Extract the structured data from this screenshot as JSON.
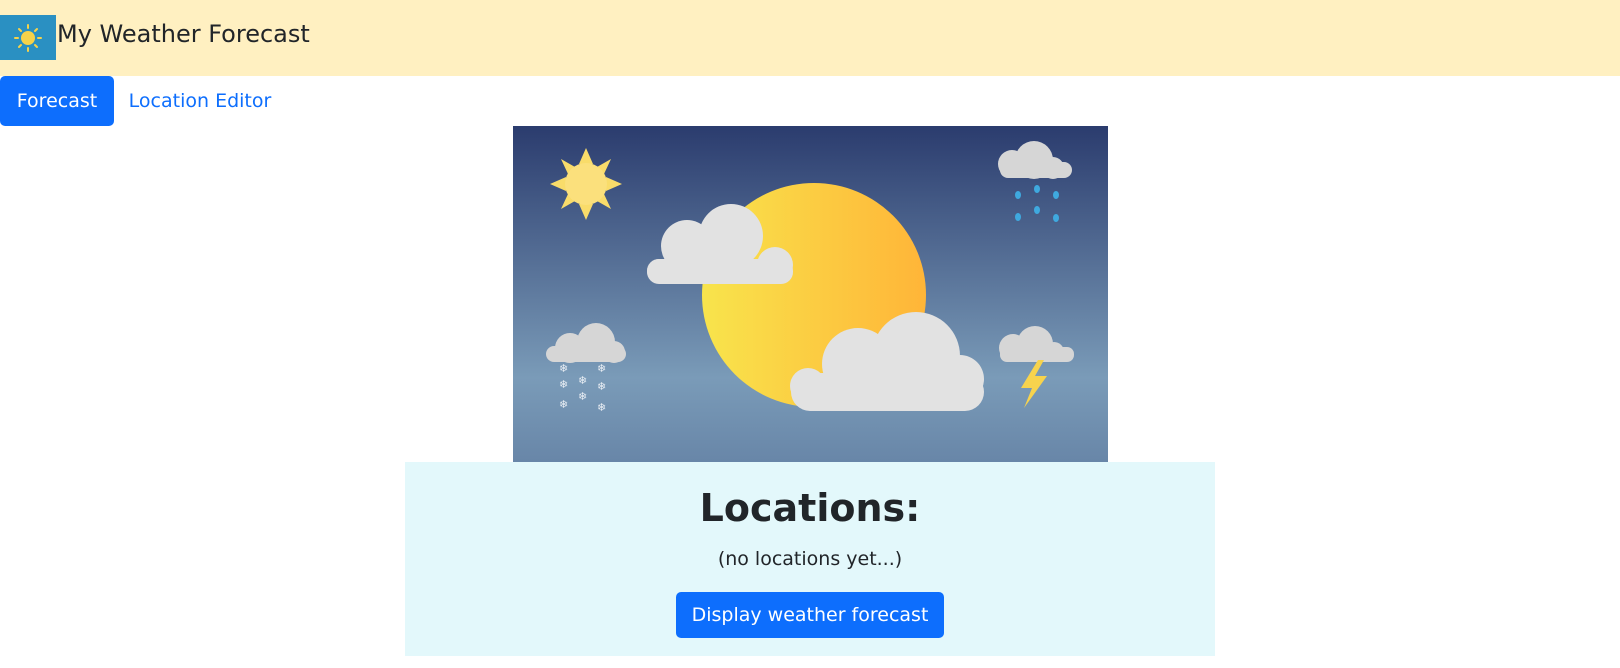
{
  "header": {
    "title": "My Weather Forecast",
    "logo_icon": "sun-icon",
    "background": "#fff0c1"
  },
  "tabs": [
    {
      "label": "Forecast",
      "active": true
    },
    {
      "label": "Location Editor",
      "active": false
    }
  ],
  "hero": {
    "icons": [
      "sun-icon",
      "rain-cloud-icon",
      "snow-cloud-icon",
      "thunder-cloud-icon",
      "cloud-icon"
    ]
  },
  "locations": {
    "title": "Locations:",
    "empty_text": "(no locations yet...)",
    "button_label": "Display weather forecast"
  },
  "colors": {
    "accent": "#0d6efd",
    "panel_bg": "#e3f8fb"
  }
}
